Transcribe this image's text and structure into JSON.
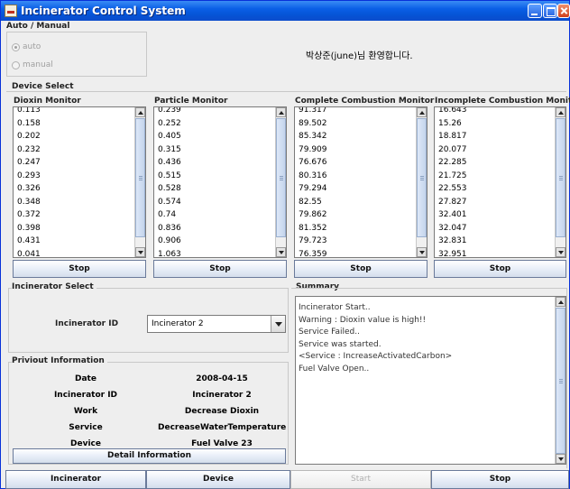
{
  "window": {
    "title": "Incinerator Control System"
  },
  "mode": {
    "group_label": "Auto / Manual",
    "options": [
      {
        "label": "auto",
        "selected": true
      },
      {
        "label": "manual",
        "selected": false
      }
    ]
  },
  "welcome_text": "박상준(june)님 환영합니다.",
  "device_select": {
    "label": "Device Select",
    "monitors": [
      {
        "title": "Dioxin Monitor",
        "stop_label": "Stop",
        "values": [
          "0.113",
          "0.158",
          "0.202",
          "0.232",
          "0.247",
          "0.293",
          "0.326",
          "0.348",
          "0.372",
          "0.398",
          "0.431",
          "0.041"
        ]
      },
      {
        "title": "Particle Monitor",
        "stop_label": "Stop",
        "values": [
          "0.239",
          "0.252",
          "0.405",
          "0.315",
          "0.436",
          "0.515",
          "0.528",
          "0.574",
          "0.74",
          "0.836",
          "0.906",
          "1.063"
        ]
      },
      {
        "title": "Complete Combustion Monitor",
        "stop_label": "Stop",
        "values": [
          "91.317",
          "89.502",
          "85.342",
          "79.909",
          "76.676",
          "80.316",
          "79.294",
          "82.55",
          "79.862",
          "81.352",
          "79.723",
          "76.359"
        ]
      },
      {
        "title": "Incomplete Combustion Monitor",
        "stop_label": "Stop",
        "values": [
          "16.643",
          "15.26",
          "18.817",
          "20.077",
          "22.285",
          "21.725",
          "22.553",
          "27.827",
          "32.401",
          "32.047",
          "32.831",
          "32.951"
        ]
      }
    ]
  },
  "incinerator_select": {
    "label": "Incinerator Select",
    "id_label": "Incinerator ID",
    "selected": "Incinerator 2"
  },
  "previous_info": {
    "label": "Priviout Information",
    "rows": [
      {
        "key": "Date",
        "value": "2008-04-15"
      },
      {
        "key": "Incinerator ID",
        "value": "Incinerator 2"
      },
      {
        "key": "Work",
        "value": "Decrease Dioxin"
      },
      {
        "key": "Service",
        "value": "DecreaseWaterTemperature"
      },
      {
        "key": "Device",
        "value": "Fuel Valve 23"
      }
    ],
    "detail_button": "Detail Information"
  },
  "summary": {
    "label": "Summary",
    "lines": [
      "Incinerator Start..",
      "Warning : Dioxin value is high!!",
      "Service Failed..",
      "Service was started.",
      "<Service : IncreaseActivatedCarbon>",
      "Fuel Valve Open.."
    ]
  },
  "bottom_tabs": [
    {
      "label": "Incinerator",
      "enabled": true
    },
    {
      "label": "Device",
      "enabled": true
    },
    {
      "label": "Start",
      "enabled": false
    },
    {
      "label": "Stop",
      "enabled": true
    }
  ]
}
